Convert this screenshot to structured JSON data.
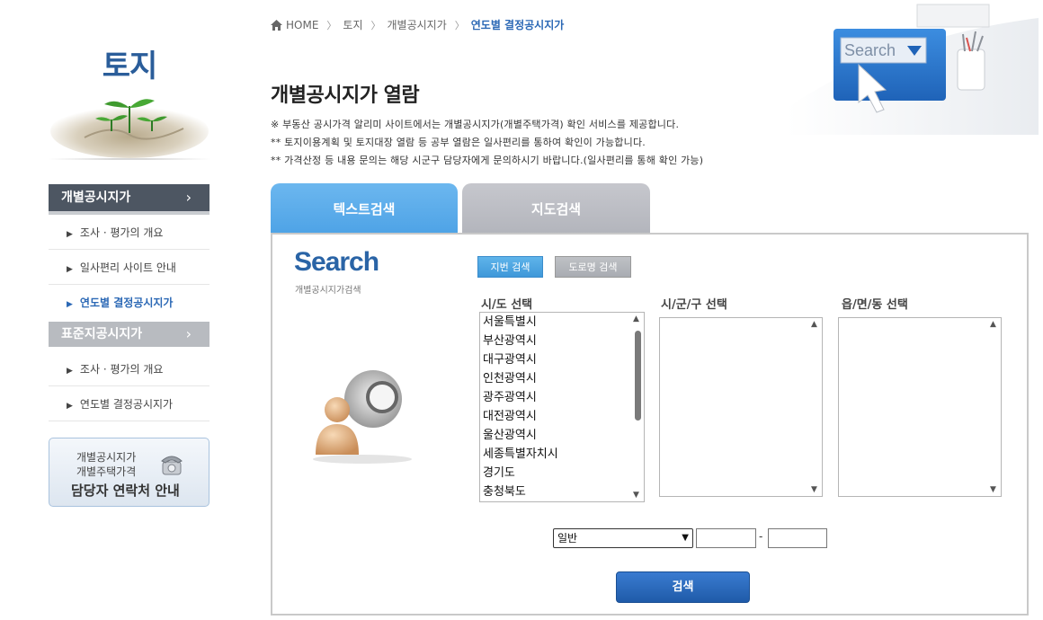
{
  "sidebar": {
    "title": "토지",
    "groups": [
      {
        "label": "개별공시지가",
        "chevron": "›"
      },
      {
        "label": "표준지공시지가",
        "chevron": "›"
      }
    ],
    "group1_items": [
      "조사 · 평가의 개요",
      "일사편리 사이트 안내",
      "연도별 결정공시지가"
    ],
    "group2_items": [
      "조사 · 평가의 개요",
      "연도별 결정공시지가"
    ],
    "bullet": "▶",
    "contact": {
      "line1": "개별공시지가",
      "line2": "개별주택가격",
      "line3": "담당자 연락처 안내"
    }
  },
  "breadcrumb": {
    "items": [
      "HOME",
      "토지",
      "개별공시지가",
      "연도별 결정공시지가"
    ],
    "separator": "〉"
  },
  "header_illust": {
    "search_text": "Search"
  },
  "page": {
    "title": "개별공시지가 열람",
    "notices": [
      "※ 부동산 공시가격 알리미 사이트에서는 개별공시지가(개별주택가격) 확인 서비스를 제공합니다.",
      "** 토지이용계획 및 토지대장 열람 등 공부 열람은 일사편리를 통하여 확인이 가능합니다.",
      "** 가격산정 등 내용 문의는 해당 시군구 담당자에게 문의하시기 바랍니다.(일사편리를 통해 확인 가능)"
    ]
  },
  "tabs": [
    "텍스트검색",
    "지도검색"
  ],
  "search": {
    "logo": "Search",
    "logo_sub": "개별공시지가검색",
    "btn_jibun": "지번 검색",
    "btn_road": "도로명 검색",
    "col_labels": [
      "시/도 선택",
      "시/군/구 선택",
      "읍/면/동 선택"
    ],
    "sido_options": [
      "서울특별시",
      "부산광역시",
      "대구광역시",
      "인천광역시",
      "광주광역시",
      "대전광역시",
      "울산광역시",
      "세종특별자치시",
      "경기도",
      "충청북도"
    ],
    "kind_selected": "일반",
    "dash": "-",
    "search_button": "검색"
  },
  "colors": {
    "accent_blue": "#2b68b5",
    "tab_active": "#4ea3e6",
    "tab_inactive": "#b3b5bc",
    "menu_dark": "#4d5662"
  },
  "icons": [
    "home-icon",
    "phone-icon",
    "search-person-icon",
    "sprout-icon",
    "search-screen-icon"
  ]
}
